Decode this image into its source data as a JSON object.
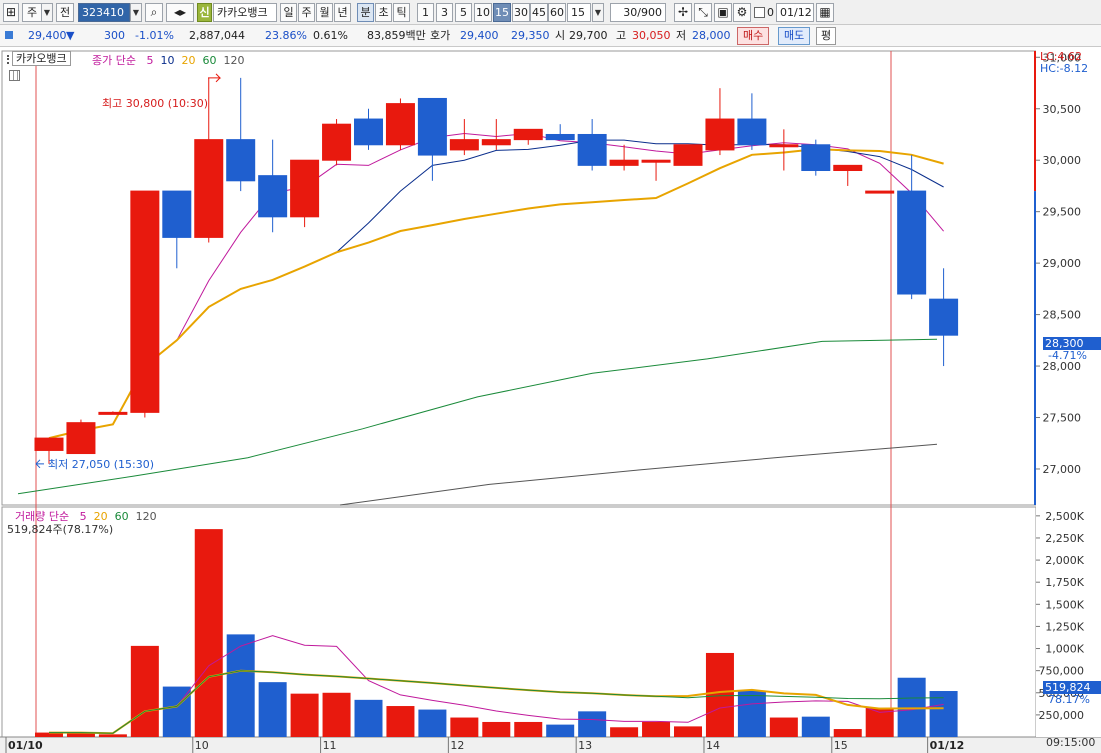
{
  "toolbar": {
    "market_kind": "주",
    "prev_label": "전",
    "code": "323410",
    "credit_badge": "신",
    "stock_name": "카카오뱅크",
    "periods": [
      "일",
      "주",
      "월",
      "년",
      "분",
      "초",
      "틱"
    ],
    "selected_period": "분",
    "minute_buttons": [
      "1",
      "3",
      "5",
      "10",
      "15",
      "30",
      "45",
      "60"
    ],
    "selected_minute": "15",
    "interval_value": "15",
    "count_value": "30/900",
    "checkbox_label": "0",
    "date_value": "01/12"
  },
  "quote": {
    "price": "29,400",
    "change_arrow": "▼",
    "change": "300",
    "change_rate": "-1.01%",
    "volume": "2,887,044",
    "turnover": "23.86%",
    "volume_rate": "0.61%",
    "amount": "83,859백만",
    "bid_label": "호가",
    "ask_price": "29,400",
    "bid_price": "29,350",
    "open_label": "시",
    "open": "29,700",
    "high_label": "고",
    "high": "30,050",
    "low_label": "저",
    "low": "28,000",
    "buy_label": "매수",
    "sell_label": "매도",
    "avg_label": "평"
  },
  "price_panel": {
    "name": "카카오뱅크",
    "legend_prefix": "종가 단순",
    "ma_periods": [
      "5",
      "10",
      "20",
      "60",
      "120"
    ],
    "ma_colors": [
      "#c0199c",
      "#0a2e8c",
      "#e8a400",
      "#1a8a3a",
      "#555555"
    ],
    "lc_label": "LC:4.62",
    "hc_label": "HC:-8.12",
    "high_callout": "최고 30,800 (10:30)",
    "low_callout": "최저 27,050 (15:30)",
    "current_price_tag": "28,300",
    "current_rate_tag": "-4.71%"
  },
  "volume_panel": {
    "title": "거래량 단순",
    "ma_periods": [
      "5",
      "20",
      "60",
      "120"
    ],
    "current_label": "519,824주(78.17%)",
    "current_tag": "519,824",
    "current_rate_tag": "78.17%"
  },
  "x_axis": {
    "labels": [
      "01/10",
      "10",
      "11",
      "12",
      "13",
      "14",
      "15",
      "01/12"
    ],
    "time_label": "09:15:00"
  },
  "colors": {
    "up": "#e8190e",
    "down": "#1f5fcf",
    "accent": "#3165a8"
  },
  "chart_data": {
    "type": "candlestick",
    "candles": [
      {
        "o": 27180,
        "h": 27300,
        "l": 27050,
        "c": 27300
      },
      {
        "o": 27150,
        "h": 27480,
        "l": 27150,
        "c": 27450
      },
      {
        "o": 27550,
        "h": 27560,
        "l": 27550,
        "c": 27550
      },
      {
        "o": 27550,
        "h": 29700,
        "l": 27500,
        "c": 29700
      },
      {
        "o": 29700,
        "h": 29700,
        "l": 28950,
        "c": 29250
      },
      {
        "o": 29250,
        "h": 30800,
        "l": 29200,
        "c": 30200
      },
      {
        "o": 30200,
        "h": 30800,
        "l": 29700,
        "c": 29800
      },
      {
        "o": 29850,
        "h": 30200,
        "l": 29300,
        "c": 29450
      },
      {
        "o": 29450,
        "h": 30000,
        "l": 29350,
        "c": 30000
      },
      {
        "o": 30000,
        "h": 30400,
        "l": 29950,
        "c": 30350
      },
      {
        "o": 30400,
        "h": 30500,
        "l": 30100,
        "c": 30150
      },
      {
        "o": 30150,
        "h": 30600,
        "l": 30100,
        "c": 30550
      },
      {
        "o": 30600,
        "h": 30600,
        "l": 29800,
        "c": 30050
      },
      {
        "o": 30100,
        "h": 30400,
        "l": 30050,
        "c": 30200
      },
      {
        "o": 30150,
        "h": 30400,
        "l": 30100,
        "c": 30200
      },
      {
        "o": 30200,
        "h": 30300,
        "l": 30150,
        "c": 30300
      },
      {
        "o": 30250,
        "h": 30350,
        "l": 30200,
        "c": 30200
      },
      {
        "o": 30250,
        "h": 30400,
        "l": 29900,
        "c": 29950
      },
      {
        "o": 29950,
        "h": 30150,
        "l": 29900,
        "c": 30000
      },
      {
        "o": 30000,
        "h": 30000,
        "l": 29800,
        "c": 30000
      },
      {
        "o": 29950,
        "h": 30150,
        "l": 29950,
        "c": 30150
      },
      {
        "o": 30100,
        "h": 30700,
        "l": 30050,
        "c": 30400
      },
      {
        "o": 30400,
        "h": 30650,
        "l": 30100,
        "c": 30150
      },
      {
        "o": 30150,
        "h": 30300,
        "l": 29900,
        "c": 30150
      },
      {
        "o": 30150,
        "h": 30200,
        "l": 29850,
        "c": 29900
      },
      {
        "o": 29900,
        "h": 29950,
        "l": 29750,
        "c": 29950
      },
      {
        "o": 29700,
        "h": 29700,
        "l": 29700,
        "c": 29700
      },
      {
        "o": 29700,
        "h": 30050,
        "l": 28650,
        "c": 28700
      },
      {
        "o": 28650,
        "h": 28950,
        "l": 28000,
        "c": 28300
      }
    ],
    "volume": [
      50000,
      50000,
      30000,
      1030000,
      570000,
      2350000,
      1160000,
      620000,
      490000,
      500000,
      420000,
      350000,
      310000,
      220000,
      170000,
      170000,
      140000,
      290000,
      110000,
      170000,
      120000,
      950000,
      520000,
      220000,
      230000,
      90000,
      330000,
      670000,
      519824
    ],
    "price_ylim": [
      26650,
      31100
    ],
    "price_ticks": [
      "31,000",
      "30,500",
      "30,000",
      "29,500",
      "29,000",
      "28,500",
      "28,000",
      "27,500",
      "27,000"
    ],
    "volume_ylim": [
      0,
      2600000
    ],
    "volume_ticks": [
      "2,500K",
      "2,250K",
      "2,000K",
      "1,750K",
      "1,500K",
      "1,250K",
      "1,000K",
      "750,000",
      "500,000",
      "250,000"
    ],
    "ma60_values": [
      26760,
      26930,
      27110,
      27390,
      27700,
      27930,
      28070,
      28240,
      28260
    ],
    "ma120_values": [
      26650,
      26850,
      26990,
      27120,
      27240
    ],
    "day_boundaries": [
      0,
      4.5,
      8.5,
      12.5,
      16.5,
      20.5,
      24.5,
      27.5
    ]
  }
}
